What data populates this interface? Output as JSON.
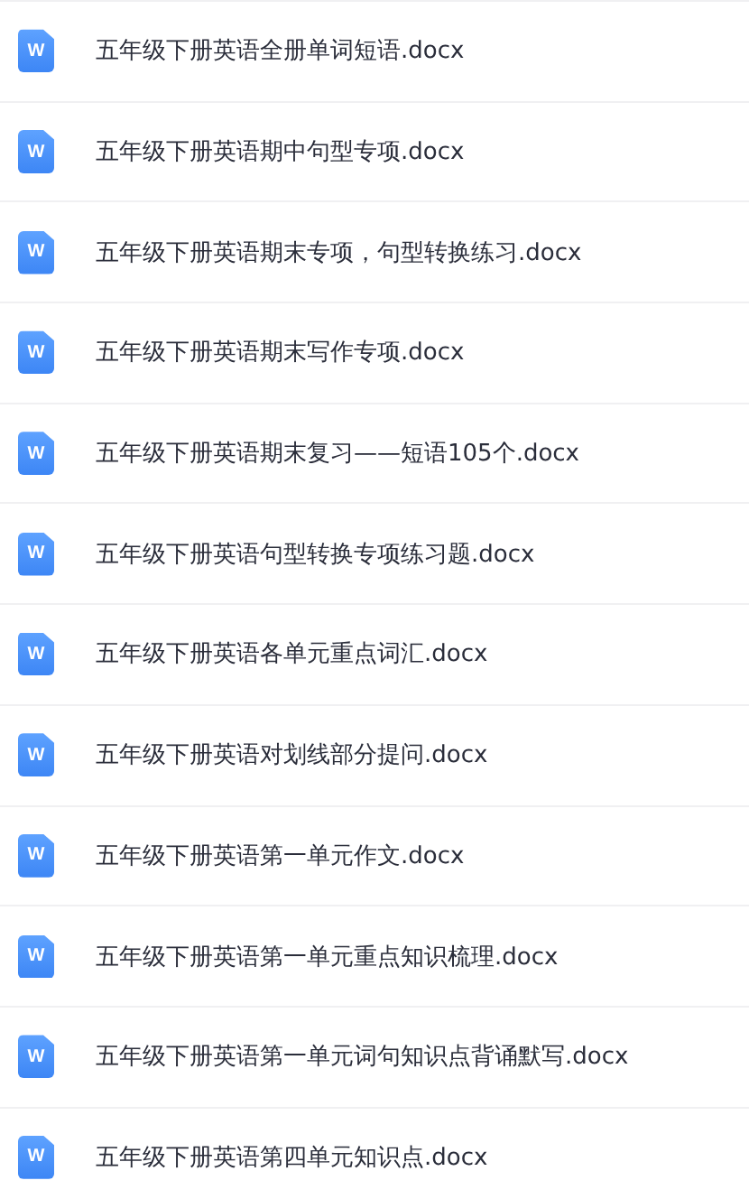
{
  "files": [
    {
      "name": "五年级下册英语全册单词短语.docx",
      "icon_label": "W"
    },
    {
      "name": "五年级下册英语期中句型专项.docx",
      "icon_label": "W"
    },
    {
      "name": "五年级下册英语期末专项，句型转换练习.docx",
      "icon_label": "W"
    },
    {
      "name": "五年级下册英语期末写作专项.docx",
      "icon_label": "W"
    },
    {
      "name": "五年级下册英语期末复习——短语105个.docx",
      "icon_label": "W"
    },
    {
      "name": "五年级下册英语句型转换专项练习题.docx",
      "icon_label": "W"
    },
    {
      "name": "五年级下册英语各单元重点词汇.docx",
      "icon_label": "W"
    },
    {
      "name": "五年级下册英语对划线部分提问.docx",
      "icon_label": "W"
    },
    {
      "name": "五年级下册英语第一单元作文.docx",
      "icon_label": "W"
    },
    {
      "name": "五年级下册英语第一单元重点知识梳理.docx",
      "icon_label": "W"
    },
    {
      "name": "五年级下册英语第一单元词句知识点背诵默写.docx",
      "icon_label": "W"
    },
    {
      "name": "五年级下册英语第四单元知识点.docx",
      "icon_label": "W"
    }
  ]
}
